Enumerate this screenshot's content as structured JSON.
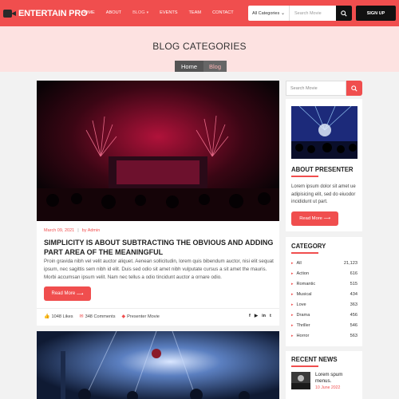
{
  "header": {
    "brand": "ENTERTAIN PRO",
    "nav": [
      {
        "label": "HOME",
        "active": false
      },
      {
        "label": "ABOUT",
        "active": false
      },
      {
        "label": "BLOG",
        "active": true
      },
      {
        "label": "EVENTS",
        "active": false
      },
      {
        "label": "TEAM",
        "active": false
      },
      {
        "label": "CONTACT",
        "active": false
      }
    ],
    "category_select": "All Categories",
    "search_placeholder": "Search Movie",
    "signup_label": "SIGN UP"
  },
  "banner": {
    "title": "BLOG CATEGORIES",
    "breadcrumb": [
      "Home",
      "Blog"
    ]
  },
  "posts": [
    {
      "date": "March 09, 2021",
      "author": "by Admin",
      "title": "SIMPLICITY IS ABOUT SUBTRACTING THE OBVIOUS AND ADDING PART AREA OF THE MEANINGFUL",
      "excerpt": "Proin gravida nibh vel velit auctor aliquet. Aenean sollicitudin, lorem quis bibendum auctor, nisi elit sequat ipsum, nec sagittis sem nibh id elit. Duis sed odio sit amet nibh vulputate cursus a sit amet the mauris. Morbi accumsan ipsum velit. Nam nec tellus a odio tincidunt auctor a ornare odio.",
      "read_more": "Read More",
      "likes": "1048 Likes",
      "comments": "348 Comments",
      "tag": "Presenter Movie"
    }
  ],
  "sidebar": {
    "search_placeholder": "Search Movie",
    "about": {
      "heading": "ABOUT PRESENTER",
      "text": "Lorem ipsum dolor sit amet ue adipisicing elit, sed do eiuodor incididunt ut part.",
      "button": "Read More"
    },
    "category": {
      "heading": "CATEGORY",
      "items": [
        {
          "name": "All",
          "count": "21,123"
        },
        {
          "name": "Action",
          "count": "616"
        },
        {
          "name": "Romantic",
          "count": "515"
        },
        {
          "name": "Musical",
          "count": "434"
        },
        {
          "name": "Love",
          "count": "363"
        },
        {
          "name": "Drama",
          "count": "456"
        },
        {
          "name": "Thriller",
          "count": "546"
        },
        {
          "name": "Horror",
          "count": "563"
        }
      ]
    },
    "news": {
      "heading": "RECENT NEWS",
      "title": "Lorem spum menus.",
      "date": "10 June 2022"
    }
  },
  "colors": {
    "accent": "#f04e4e",
    "banner_bg": "#fde2e1",
    "dark": "#111111"
  }
}
